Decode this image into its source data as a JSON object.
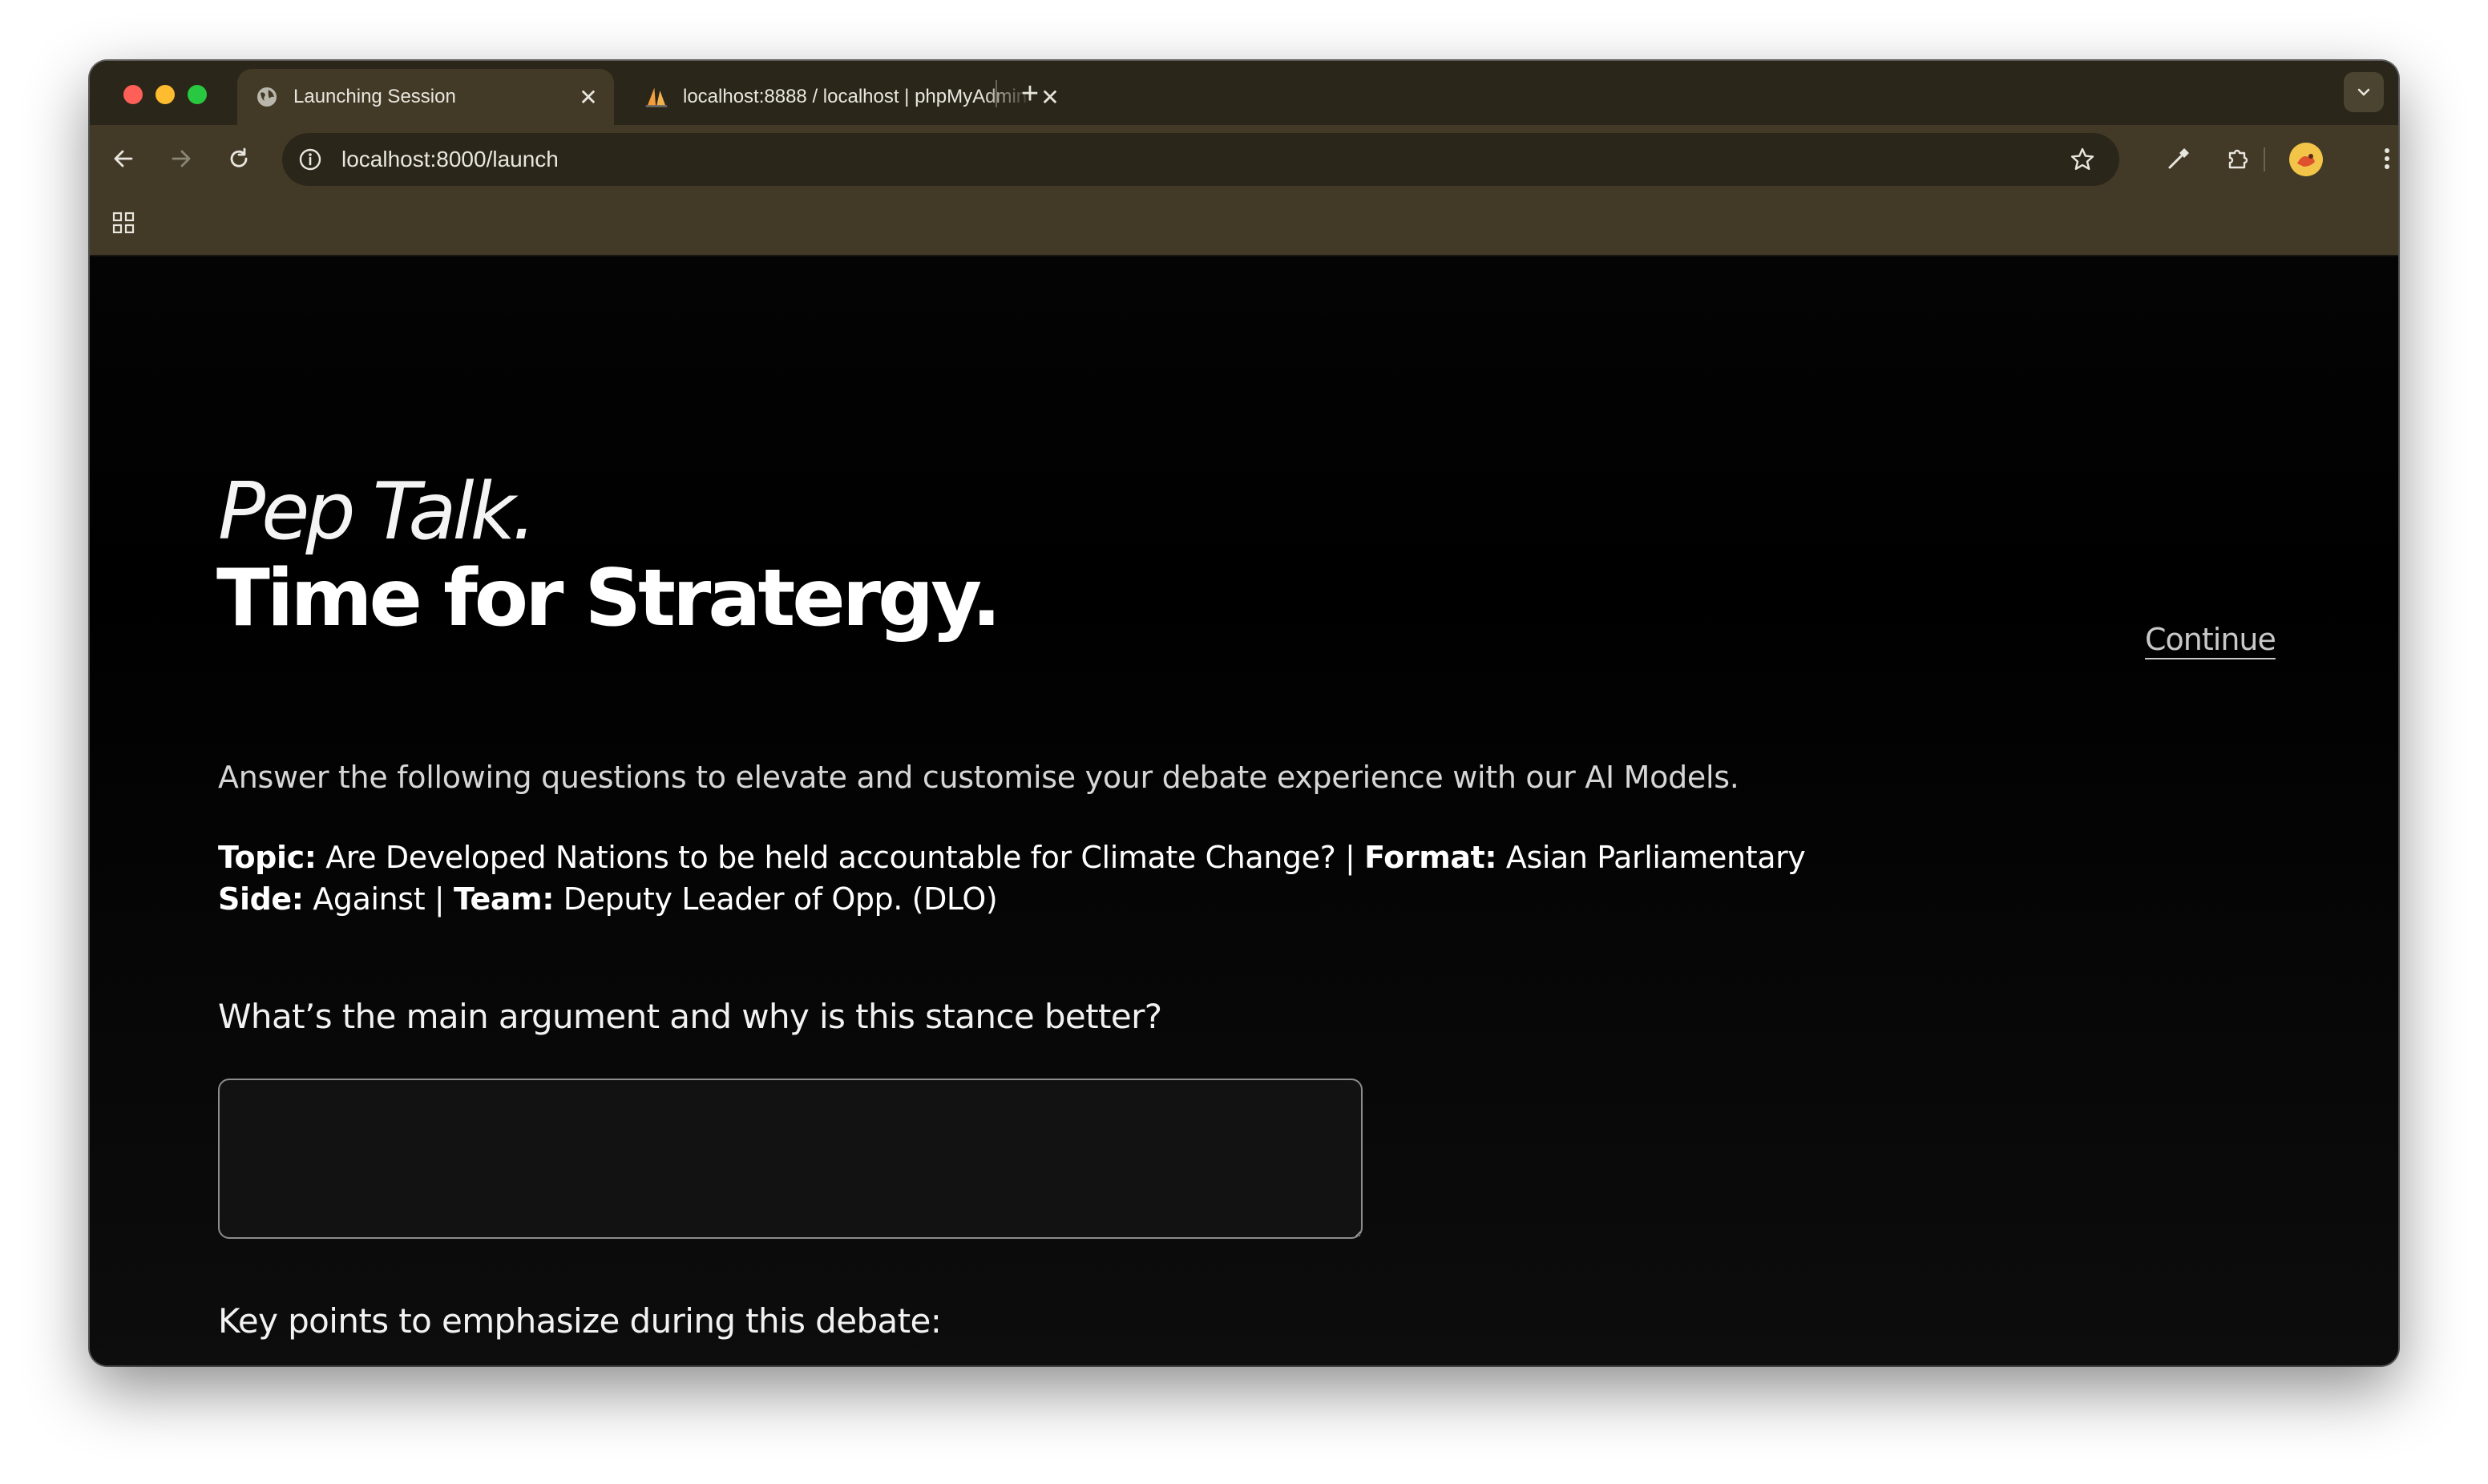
{
  "browser": {
    "tabs": [
      {
        "title": "Launching Session",
        "active": true,
        "icon": "globe-icon"
      },
      {
        "title": "localhost:8888 / localhost | phpMyAdmin",
        "active": false,
        "icon": "phpmyadmin-sail-icon"
      }
    ],
    "url": "localhost:8000/launch"
  },
  "page": {
    "hero_line1": "Pep Talk.",
    "hero_line2": "Time for Stratergy.",
    "continue_label": "Continue",
    "intro": "Answer the following questions to elevate and customise your debate experience with our AI Models.",
    "meta": {
      "topic_label": "Topic:",
      "topic_value": " Are Developed Nations to be held accountable for Climate Change? | ",
      "format_label": "Format:",
      "format_value": " Asian Parliamentary",
      "side_label": "Side:",
      "side_value": " Against | ",
      "team_label": "Team:",
      "team_value": " Deputy Leader of Opp. (DLO)"
    },
    "questions": [
      {
        "label": "What’s the main argument and why is this stance better?",
        "value": ""
      },
      {
        "label": "Key points to emphasize during this debate:",
        "value": ""
      }
    ]
  },
  "colors": {
    "chrome_dark": "#2a2619",
    "chrome_mid": "#423a26",
    "page_bg": "#000000",
    "text_primary": "#ffffff",
    "continue_link": "#c8c8c8"
  }
}
